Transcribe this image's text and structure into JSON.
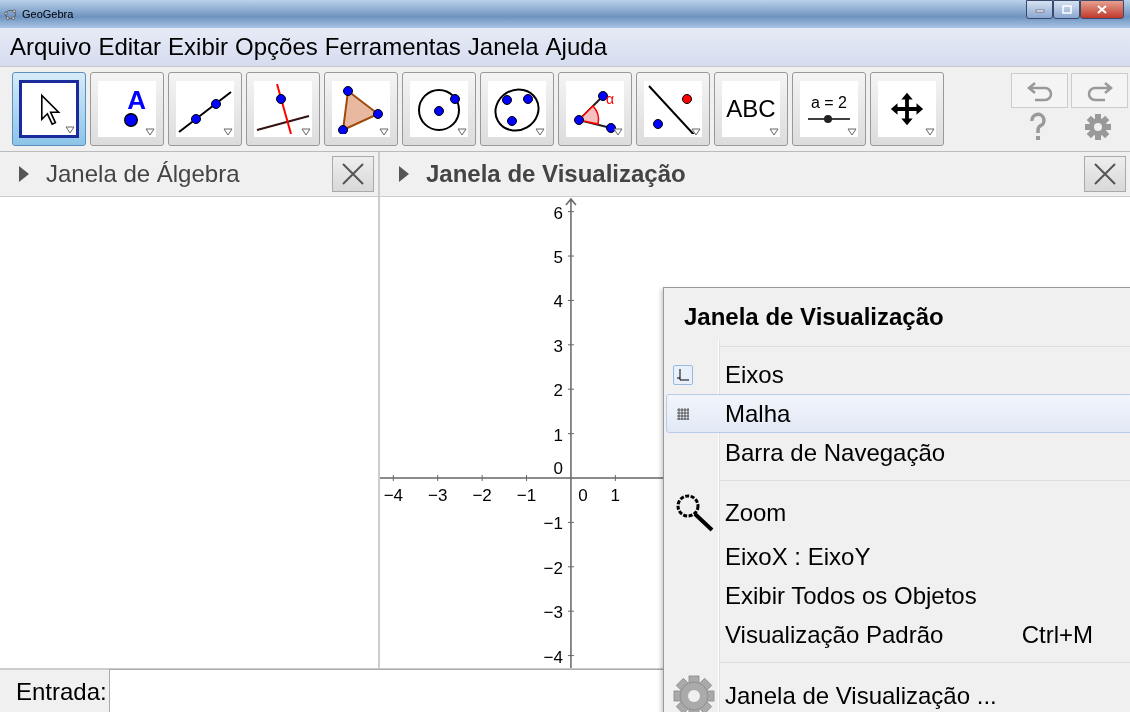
{
  "window": {
    "title": "GeoGebra"
  },
  "menu_bar": [
    "Arquivo",
    "Editar",
    "Exibir",
    "Opções",
    "Ferramentas",
    "Janela",
    "Ajuda"
  ],
  "toolbar": {
    "tools": [
      {
        "kind": "move",
        "selected": true
      },
      {
        "kind": "point",
        "label": "A",
        "selected": false
      },
      {
        "kind": "line",
        "selected": false
      },
      {
        "kind": "perpendicular",
        "selected": false
      },
      {
        "kind": "polygon",
        "selected": false
      },
      {
        "kind": "circle",
        "selected": false
      },
      {
        "kind": "conic",
        "selected": false
      },
      {
        "kind": "angle",
        "label": "α",
        "selected": false
      },
      {
        "kind": "reflect",
        "selected": false
      },
      {
        "kind": "text",
        "label": "ABC",
        "selected": false
      },
      {
        "kind": "slider",
        "label": "a = 2",
        "selected": false
      },
      {
        "kind": "pan",
        "selected": false
      }
    ]
  },
  "algebra_view": {
    "title": "Janela de Álgebra"
  },
  "graphics_view": {
    "title": "Janela de Visualização",
    "x_axis_origin_label": "0",
    "y_axis_origin_label": "0",
    "chart_data": {
      "type": "scatter",
      "xlim": [
        -4.3,
        12.59
      ],
      "ylim": [
        -4.28,
        6.33
      ],
      "xticks": [
        {
          "value": -4,
          "label": "−4"
        },
        {
          "value": -3,
          "label": "−3"
        },
        {
          "value": -2,
          "label": "−2"
        },
        {
          "value": -1,
          "label": "−1"
        },
        {
          "value": 1,
          "label": "1"
        }
      ],
      "yticks": [
        {
          "value": -4,
          "label": "−4"
        },
        {
          "value": -3,
          "label": "−3"
        },
        {
          "value": -2,
          "label": "−2"
        },
        {
          "value": -1,
          "label": "−1"
        },
        {
          "value": 1,
          "label": "1"
        },
        {
          "value": 2,
          "label": "2"
        },
        {
          "value": 3,
          "label": "3"
        },
        {
          "value": 4,
          "label": "4"
        },
        {
          "value": 5,
          "label": "5"
        },
        {
          "value": 6,
          "label": "6"
        }
      ]
    }
  },
  "input_bar": {
    "label": "Entrada:"
  },
  "context_menu": {
    "title": "Janela de Visualização",
    "sections": [
      {
        "items": [
          {
            "kind": "axes",
            "label": "Eixos",
            "checked": true,
            "selected": false
          },
          {
            "kind": "grid",
            "label": "Malha",
            "checked": false,
            "selected": true
          },
          {
            "kind": "toggle",
            "label": "Barra de Navegação",
            "checked": false,
            "selected": false
          }
        ]
      },
      {
        "items": [
          {
            "kind": "zoom",
            "label": "Zoom",
            "selected": false
          },
          {
            "kind": "action",
            "label": "EixoX : EixoY",
            "selected": false
          },
          {
            "kind": "action",
            "label": "Exibir Todos os Objetos",
            "selected": false
          },
          {
            "kind": "action",
            "label": "Visualização Padrão",
            "shortcut": "Ctrl+M",
            "selected": false
          }
        ]
      },
      {
        "items": [
          {
            "kind": "settings",
            "label": "Janela de Visualização ...",
            "selected": false
          }
        ]
      }
    ]
  }
}
